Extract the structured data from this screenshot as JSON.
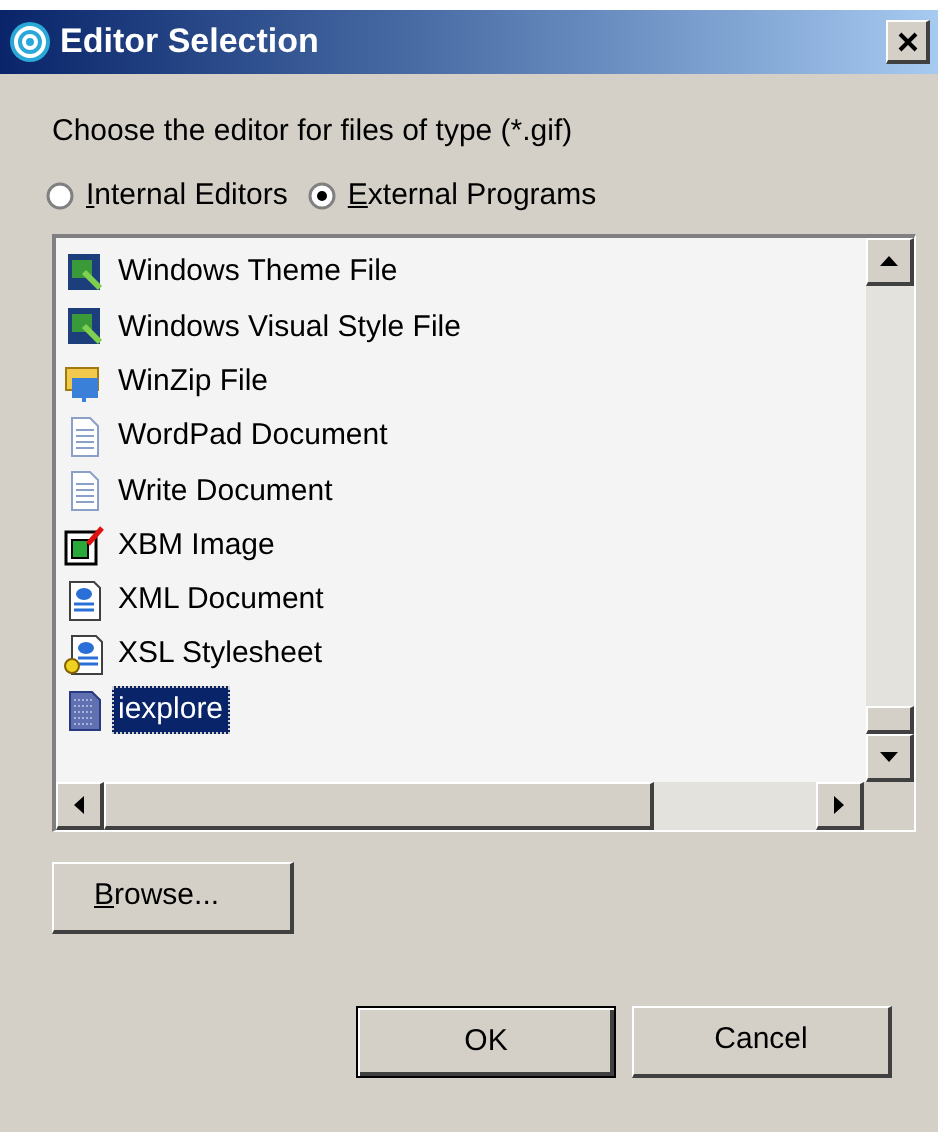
{
  "window": {
    "title": "Editor Selection"
  },
  "prompt": "Choose the editor for files of type (*.gif)",
  "radios": [
    {
      "label": "Internal Editors",
      "selected": false
    },
    {
      "label": "External Programs",
      "selected": true
    }
  ],
  "items": [
    {
      "label": "Windows Theme File",
      "kind": "theme",
      "selected": false
    },
    {
      "label": "Windows Visual Style File",
      "kind": "theme",
      "selected": false
    },
    {
      "label": "WinZip File",
      "kind": "zip",
      "selected": false
    },
    {
      "label": "WordPad Document",
      "kind": "doc",
      "selected": false
    },
    {
      "label": "Write Document",
      "kind": "doc",
      "selected": false
    },
    {
      "label": "XBM Image",
      "kind": "xbm",
      "selected": false
    },
    {
      "label": "XML Document",
      "kind": "xml",
      "selected": false
    },
    {
      "label": "XSL Stylesheet",
      "kind": "xsl",
      "selected": false
    },
    {
      "label": "iexplore",
      "kind": "program",
      "selected": true
    }
  ],
  "browse_button": "Browse...",
  "buttons": [
    "OK",
    "Cancel"
  ]
}
